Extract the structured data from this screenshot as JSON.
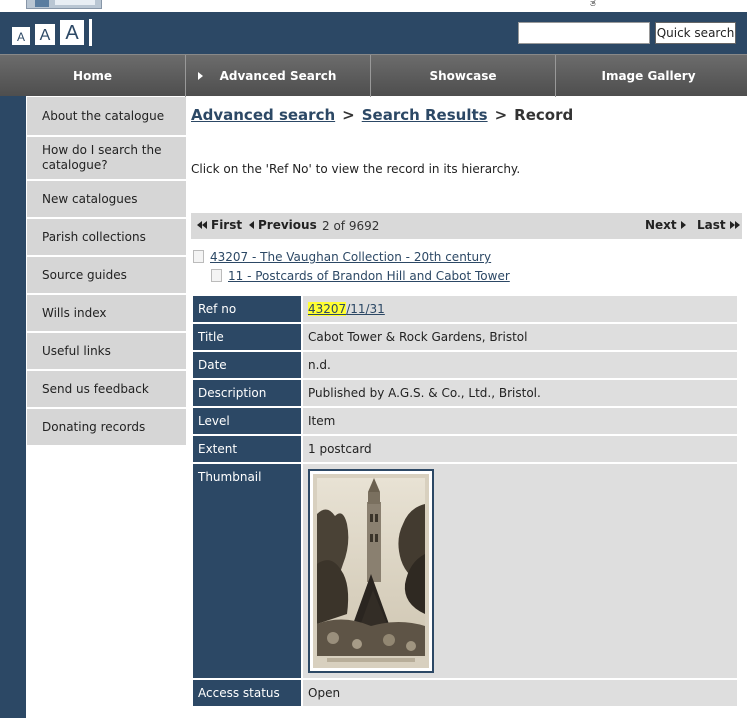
{
  "header": {
    "font_sizes": [
      "A",
      "A",
      "A"
    ],
    "search_placeholder": "",
    "search_button": "Quick search"
  },
  "nav": {
    "home": "Home",
    "advanced_search": "Advanced Search",
    "showcase": "Showcase",
    "image_gallery": "Image Gallery"
  },
  "sidebar": {
    "items": [
      {
        "label": "About the catalogue"
      },
      {
        "label": "How do I search the catalogue?"
      },
      {
        "label": "New catalogues"
      },
      {
        "label": "Parish collections"
      },
      {
        "label": "Source guides"
      },
      {
        "label": "Wills index"
      },
      {
        "label": "Useful links"
      },
      {
        "label": "Send us feedback"
      },
      {
        "label": "Donating records"
      }
    ]
  },
  "breadcrumb": {
    "advanced_search": "Advanced search",
    "sep1": ">",
    "search_results": "Search Results",
    "sep2": ">",
    "current": "Record"
  },
  "instructions": "Click on the 'Ref No' to view the record in its hierarchy.",
  "pager": {
    "first": "First",
    "previous": "Previous",
    "count": "2 of 9692",
    "next": "Next",
    "last": "Last"
  },
  "hierarchy": [
    {
      "label": "43207 - The Vaughan Collection - 20th century"
    },
    {
      "label": "11 - Postcards of Brandon Hill and Cabot Tower"
    }
  ],
  "record": {
    "ref_no_label": "Ref no",
    "ref_no_part1": "43207",
    "ref_no_part2": "/11/31",
    "title_label": "Title",
    "title": "Cabot Tower & Rock Gardens, Bristol",
    "date_label": "Date",
    "date": "n.d.",
    "description_label": "Description",
    "description": "Published by A.G.S. & Co., Ltd., Bristol.",
    "level_label": "Level",
    "level": "Item",
    "extent_label": "Extent",
    "extent": "1 postcard",
    "thumbnail_label": "Thumbnail",
    "access_status_label": "Access status",
    "access_status": "Open"
  },
  "colors": {
    "brand_navy": "#2c4865",
    "nav_gray": "#5c5c5c",
    "row_gray": "#dedede",
    "highlight": "#ffff33"
  },
  "icons": {
    "logo_glyph": "ತ",
    "doc": "document-icon"
  }
}
